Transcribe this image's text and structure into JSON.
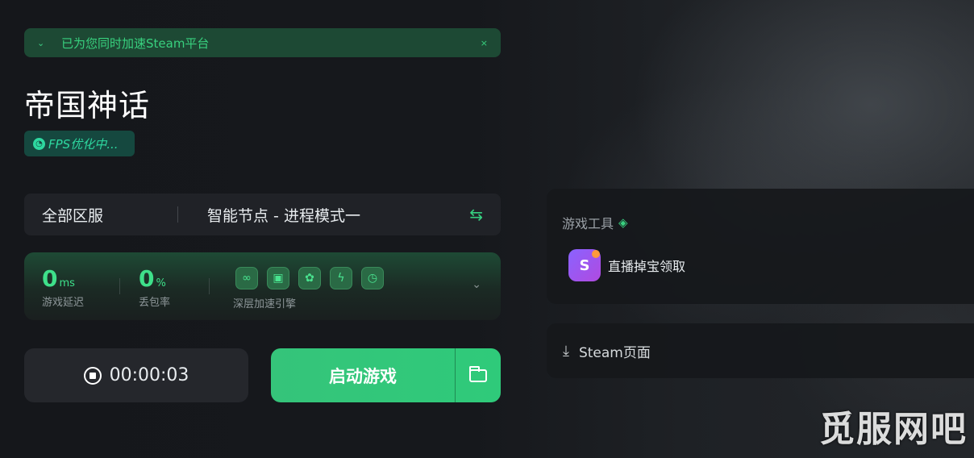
{
  "banner": {
    "chevron": "⌄",
    "text": "已为您同时加速Steam平台",
    "close": "×"
  },
  "game": {
    "title": "帝国神话",
    "fps_badge": "FPS优化中..."
  },
  "node": {
    "region": "全部区服",
    "mode": "智能节点 - 进程模式一",
    "swap_icon": "⇆"
  },
  "stats": {
    "latency": {
      "value": "0",
      "unit": "ms",
      "label": "游戏延迟"
    },
    "loss": {
      "value": "0",
      "unit": "%",
      "label": "丢包率"
    },
    "engine_label": "深层加速引擎",
    "engine_icons": [
      "link-icon",
      "shield-icon",
      "network-icon",
      "bolt-icon",
      "clock-icon"
    ],
    "dropdown": "⌄"
  },
  "timer": {
    "elapsed": "00:00:03"
  },
  "launch": {
    "label": "启动游戏"
  },
  "tools": {
    "heading": "游戏工具",
    "item_label": "直播掉宝领取"
  },
  "steam": {
    "label": "Steam页面"
  },
  "watermark": "觅服网吧",
  "colors": {
    "accent": "#36cf80",
    "banner_bg": "#1d4934",
    "launch_bg": "#35c47a"
  }
}
